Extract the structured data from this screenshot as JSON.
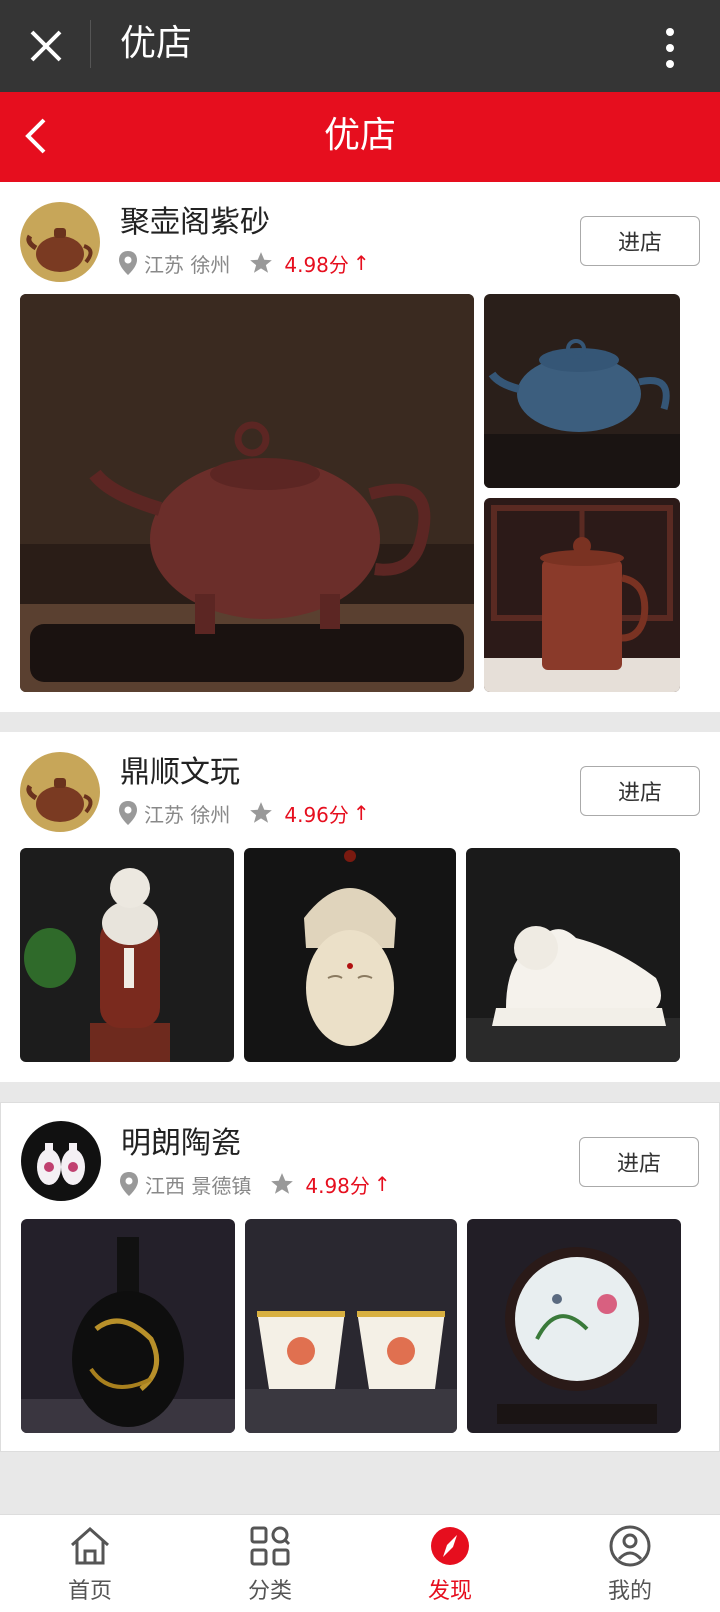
{
  "topbar": {
    "title": "优店"
  },
  "header": {
    "title": "优店"
  },
  "shops": [
    {
      "name": "聚壶阁紫砂",
      "location": "江苏 徐州",
      "score": "4.98分",
      "trend": "↑",
      "button": "进店"
    },
    {
      "name": "鼎顺文玩",
      "location": "江苏 徐州",
      "score": "4.96分",
      "trend": "↑",
      "button": "进店"
    },
    {
      "name": "明朗陶瓷",
      "location": "江西 景德镇",
      "score": "4.98分",
      "trend": "↑",
      "button": "进店"
    }
  ],
  "tabs": [
    {
      "label": "首页",
      "icon": "home-icon"
    },
    {
      "label": "分类",
      "icon": "category-icon"
    },
    {
      "label": "发现",
      "icon": "discover-icon",
      "active": true
    },
    {
      "label": "我的",
      "icon": "profile-icon"
    }
  ],
  "colors": {
    "accent": "#e60e1e",
    "topbar": "#353535"
  }
}
